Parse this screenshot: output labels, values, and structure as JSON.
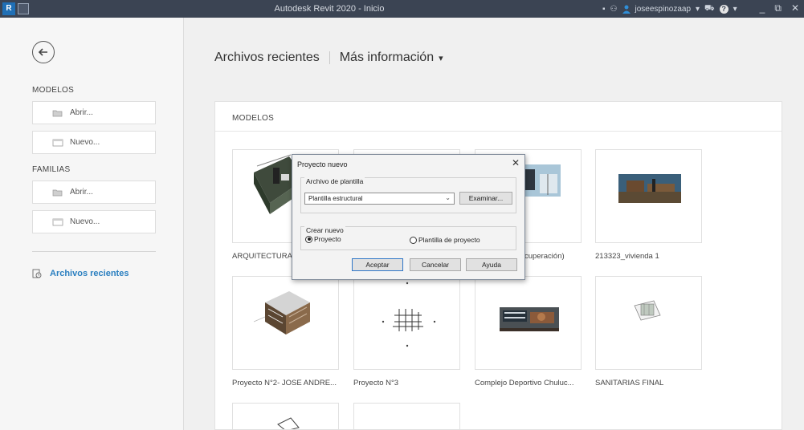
{
  "window": {
    "title": "Autodesk Revit 2020 - Inicio",
    "user": "joseespinozaap",
    "logo": "R"
  },
  "sidebar": {
    "models_heading": "MODELOS",
    "models_open": "Abrir...",
    "models_new": "Nuevo...",
    "families_heading": "FAMILIAS",
    "families_open": "Abrir...",
    "families_new": "Nuevo...",
    "recent": "Archivos recientes"
  },
  "main": {
    "recent_title": "Archivos recientes",
    "more_info": "Más información",
    "caret": "▾",
    "section_heading": "MODELOS",
    "cards": [
      {
        "label": "ARQUITECTURA"
      },
      {
        "label": ""
      },
      {
        "label": "cuperación)"
      },
      {
        "label": "213323_vivienda 1"
      },
      {
        "label": "Proyecto N°2- JOSE ANDRE..."
      },
      {
        "label": "Proyecto N°3"
      },
      {
        "label": "Complejo Deportivo Chuluc..."
      },
      {
        "label": "SANITARIAS FINAL"
      }
    ]
  },
  "dialog": {
    "title": "Proyecto nuevo",
    "close": "✕",
    "template_group": "Archivo de plantilla",
    "template_value": "Plantilla estructural",
    "browse": "Examinar...",
    "create_group": "Crear nuevo",
    "option_project": "Proyecto",
    "option_template": "Plantilla de proyecto",
    "selected_option": "Proyecto",
    "accept": "Aceptar",
    "cancel": "Cancelar",
    "help": "Ayuda"
  },
  "colors": {
    "titlebar": "#3b4453",
    "accent": "#2a7fc0",
    "dialog_border": "#7f8a99"
  }
}
